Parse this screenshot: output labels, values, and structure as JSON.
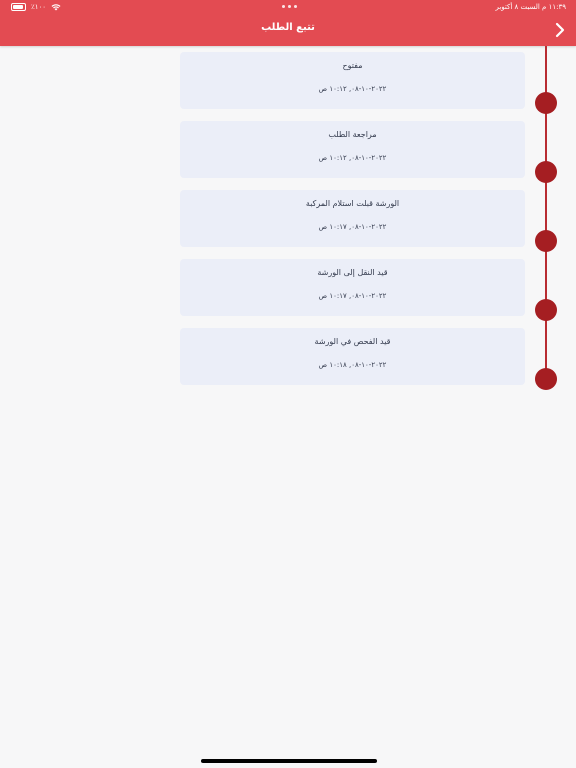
{
  "status_bar": {
    "battery_text": "٪١٠٠",
    "datetime": "١١:٣٩ م   السبت ٨ أكتوبر"
  },
  "header": {
    "title": "تتبع الطلب",
    "back_icon": "chevron-right-icon"
  },
  "timeline": [
    {
      "label": "مفتوح",
      "time": "٢٠٢٢-١٠-٠٨, ١٠:١٢ ص"
    },
    {
      "label": "مراجعة الطلب",
      "time": "٢٠٢٢-١٠-٠٨, ١٠:١٢ ص"
    },
    {
      "label": "الورشة قبلت استلام المركبة",
      "time": "٢٠٢٢-١٠-٠٨, ١٠:١٧ ص"
    },
    {
      "label": "قيد النقل إلى الورشة",
      "time": "٢٠٢٢-١٠-٠٨, ١٠:١٧ ص"
    },
    {
      "label": "قيد الفحص في الورشة",
      "time": "٢٠٢٢-١٠-٠٨, ١٠:١٨ ص"
    }
  ],
  "colors": {
    "header": "#e34b52",
    "timeline_node": "#a51e22",
    "card_bg": "#ebeef8"
  }
}
